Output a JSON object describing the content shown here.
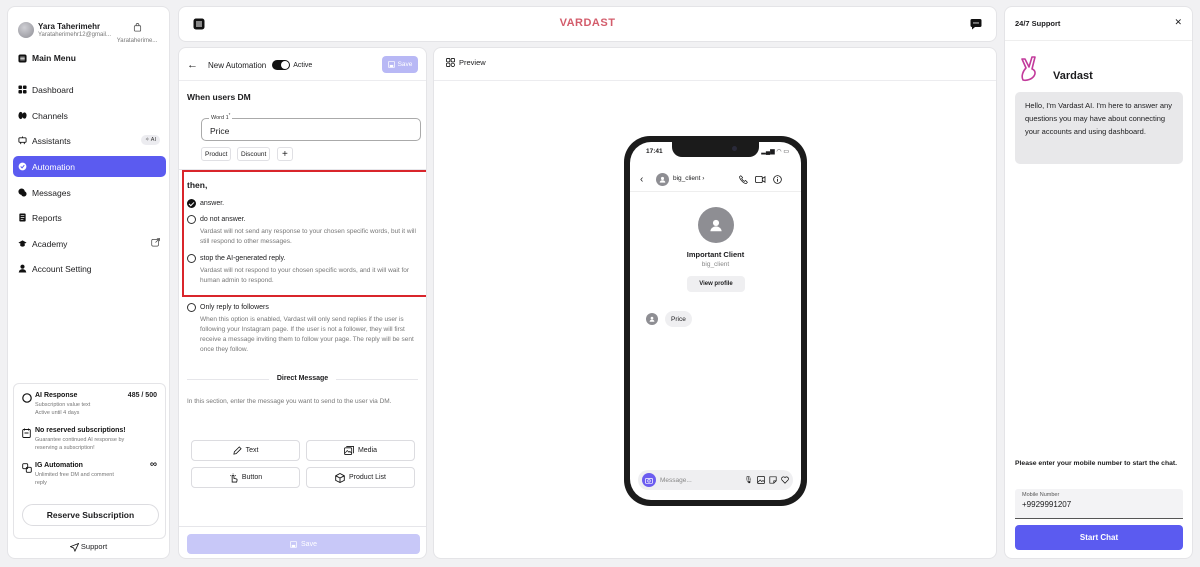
{
  "user": {
    "name": "Yara Taherimehr",
    "email": "Yarataherimehr12@gmail...",
    "handle": "Yarataherime..."
  },
  "sidebar": {
    "main_menu": "Main Menu",
    "items": [
      {
        "label": "Dashboard",
        "icon": "grid-icon"
      },
      {
        "label": "Channels",
        "icon": "channels-icon"
      },
      {
        "label": "Assistants",
        "icon": "assistant-icon",
        "badge": "AI"
      },
      {
        "label": "Automation",
        "icon": "automation-icon",
        "active": true
      },
      {
        "label": "Messages",
        "icon": "messages-icon"
      },
      {
        "label": "Reports",
        "icon": "reports-icon"
      },
      {
        "label": "Academy",
        "icon": "academy-icon"
      },
      {
        "label": "Account Setting",
        "icon": "user-icon"
      }
    ],
    "subscription": {
      "ai_response": {
        "title": "AI Response",
        "usage": "485 / 500",
        "desc": "Subscription value text",
        "desc2": "Active until 4 days"
      },
      "no_reserved": {
        "title": "No reserved subscriptions!",
        "desc": "Guarantee continued AI response by",
        "desc2": "reserving a subscription!"
      },
      "ig_automation": {
        "title": "IG Automation",
        "desc": "Unlimited free DM and comment",
        "desc2": "reply"
      },
      "reserve_button": "Reserve Subscription"
    },
    "support_link": "Support"
  },
  "header": {
    "logo": "VARDAST"
  },
  "editor": {
    "title": "New Automation",
    "active_label": "Active",
    "save_label": "Save",
    "when_title": "When users DM",
    "word_label": "Word 1",
    "word_value": "Price",
    "chips": [
      "Product",
      "Discount"
    ],
    "then_title": "then,",
    "options": [
      {
        "label": "answer.",
        "desc": "",
        "selected": true
      },
      {
        "label": "do not answer.",
        "desc": "Vardast will not send any response to your chosen specific words, but it will still respond to other messages.",
        "selected": false
      },
      {
        "label": "stop the AI-generated reply.",
        "desc": "Vardast will not respond to your chosen specific words, and it will wait for human admin to respond.",
        "selected": false
      }
    ],
    "followers": {
      "label": "Only reply to followers",
      "desc": "When this option is enabled, Vardast will only send replies if the user is following your Instagram page. If the user is not a follower, they will first receive a message inviting them to follow your page. The reply will be sent once they follow."
    },
    "dm_title": "Direct Message",
    "dm_desc": "In this section, enter the message you want to send to the user via DM.",
    "actions": [
      "Text",
      "Media",
      "Button",
      "Product List"
    ],
    "save_bottom": "Save"
  },
  "preview": {
    "title": "Preview",
    "phone": {
      "time": "17:41",
      "username": "big_client",
      "display_name": "Important Client",
      "handle": "big_client",
      "view_profile": "View profile",
      "message": "Price",
      "input_placeholder": "Message..."
    }
  },
  "support": {
    "title": "24/7 Support",
    "bot_name": "Vardast",
    "bot_message": "Hello, I'm Vardast AI. I'm here to answer any questions you may have about connecting your accounts and using dashboard.",
    "mobile_prompt": "Please enter your mobile number to start the chat.",
    "mobile_label": "Mobile Number",
    "mobile_value": "+9929991207",
    "start_button": "Start Chat"
  },
  "colors": {
    "accent": "#5b5bf0",
    "logo": "#d35c6b",
    "highlight_border": "#d9252b"
  }
}
